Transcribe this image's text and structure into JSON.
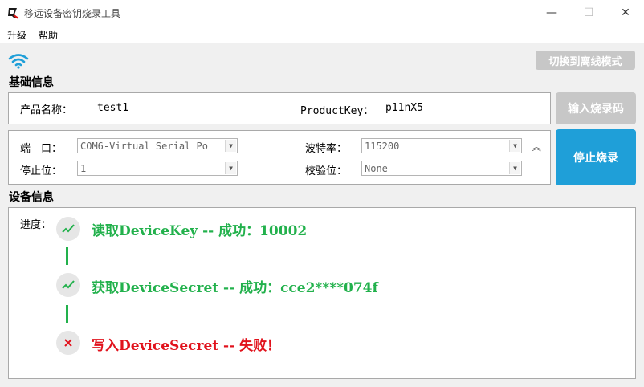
{
  "window": {
    "title": "移远设备密钥烧录工具",
    "minimize_glyph": "—",
    "maximize_glyph": "☐",
    "close_glyph": "✕"
  },
  "menu": {
    "items": [
      "升级",
      "帮助"
    ]
  },
  "toolbar": {
    "offline_mode_label": "切换到离线模式",
    "wifi_icon": "wifi-icon"
  },
  "basic_info": {
    "title": "基础信息",
    "product_name_label": "产品名称：",
    "product_name_value": "test1",
    "product_key_label": "ProductKey：",
    "product_key_value": "p11nX5"
  },
  "serial": {
    "port_label": "端　口：",
    "port_value": "COM6-Virtual Serial Po",
    "baud_label": "波特率：",
    "baud_value": "115200",
    "stopbits_label": "停止位：",
    "stopbits_value": "1",
    "parity_label": "校验位：",
    "parity_value": "None",
    "collapse_glyph": "︽"
  },
  "buttons": {
    "input_code_label": "输入烧录码",
    "stop_burn_label": "停止烧录"
  },
  "device_info": {
    "title": "设备信息",
    "progress_label": "进度：",
    "steps": [
      {
        "text": "读取DeviceKey -- 成功：10002",
        "status": "success"
      },
      {
        "text": "获取DeviceSecret -- 成功：cce2****074f",
        "status": "success"
      },
      {
        "text": "写入DeviceSecret -- 失败！",
        "status": "fail"
      }
    ]
  },
  "colors": {
    "success": "#22b14c",
    "fail": "#e1121c",
    "primary_button": "#1f9fd8",
    "disabled_button": "#c7c7c7",
    "wifi": "#1f9fd8"
  }
}
